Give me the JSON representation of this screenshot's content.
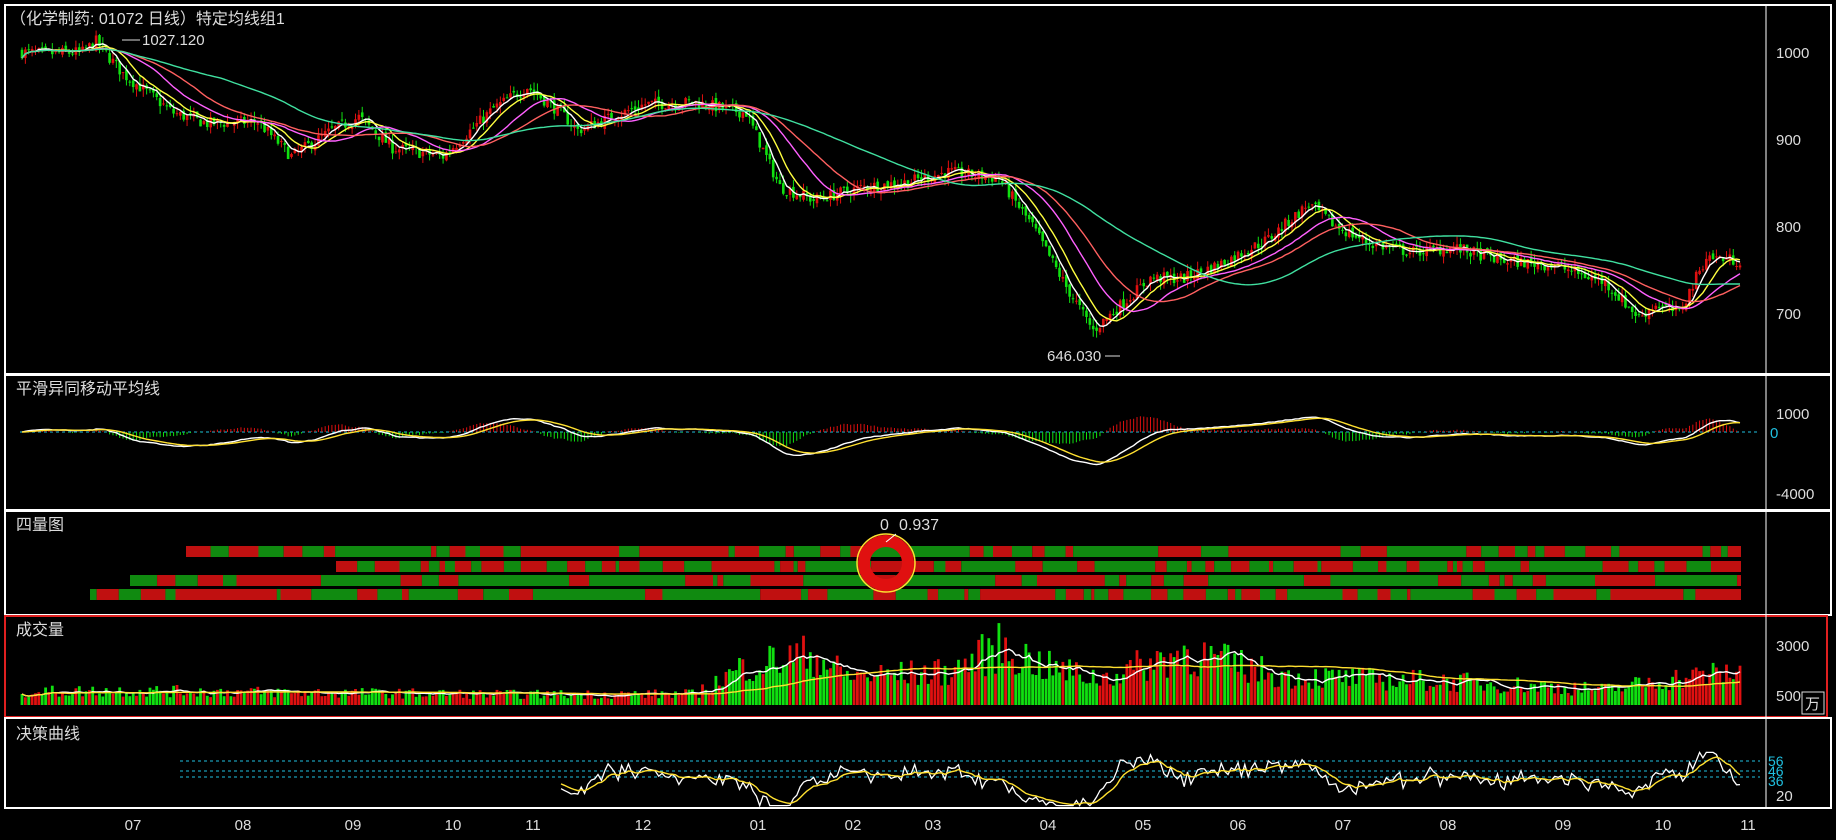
{
  "header": {
    "title": "（化学制药: 01072 日线）特定均线组1",
    "price_max_label": "1027.120",
    "price_min_label": "646.030"
  },
  "panels": {
    "main": {
      "y_ticks": [
        "1000",
        "900",
        "800",
        "700"
      ]
    },
    "macd": {
      "title": "平滑异同移动平均线",
      "y_ticks": [
        "1000",
        "0",
        "-4000"
      ]
    },
    "quad": {
      "title": "四量图",
      "readout_a": "0",
      "readout_b": "0.937"
    },
    "volume": {
      "title": "成交量",
      "y_ticks": [
        "3000",
        "500"
      ],
      "unit": "万"
    },
    "decision": {
      "title": "决策曲线",
      "y_ticks": [
        "56",
        "46",
        "36",
        "20"
      ]
    }
  },
  "x_axis": {
    "months": [
      "07",
      "08",
      "09",
      "10",
      "11",
      "12",
      "01",
      "02",
      "03",
      "04",
      "05",
      "06",
      "07",
      "08",
      "09",
      "10",
      "11"
    ]
  },
  "colors": {
    "up": "#e01010",
    "down": "#10e010",
    "border": "#ffffff",
    "selected_border": "#e02020",
    "ma": [
      "#ffffff",
      "#ffff40",
      "#ff60ff",
      "#ff6060",
      "#40e0a0"
    ],
    "zero_line": "#20c0e0"
  },
  "chart_data": {
    "type": "candlestick",
    "title": "（化学制药: 01072 日线）特定均线组1",
    "price_range": [
      646.03,
      1027.12
    ],
    "anchors": [
      [
        0,
        1000
      ],
      [
        6,
        998
      ],
      [
        18,
        1000
      ],
      [
        22,
        1012
      ],
      [
        30,
        975
      ],
      [
        45,
        930
      ],
      [
        55,
        918
      ],
      [
        70,
        920
      ],
      [
        80,
        880
      ],
      [
        92,
        910
      ],
      [
        100,
        925
      ],
      [
        110,
        890
      ],
      [
        125,
        880
      ],
      [
        140,
        935
      ],
      [
        150,
        960
      ],
      [
        160,
        930
      ],
      [
        165,
        910
      ],
      [
        185,
        940
      ],
      [
        200,
        942
      ],
      [
        215,
        930
      ],
      [
        225,
        845
      ],
      [
        235,
        830
      ],
      [
        250,
        845
      ],
      [
        262,
        850
      ],
      [
        275,
        862
      ],
      [
        290,
        855
      ],
      [
        300,
        800
      ],
      [
        310,
        730
      ],
      [
        318,
        680
      ],
      [
        325,
        705
      ],
      [
        335,
        740
      ],
      [
        345,
        740
      ],
      [
        355,
        755
      ],
      [
        370,
        785
      ],
      [
        382,
        825
      ],
      [
        390,
        800
      ],
      [
        400,
        780
      ],
      [
        412,
        770
      ],
      [
        425,
        775
      ],
      [
        440,
        760
      ],
      [
        455,
        755
      ],
      [
        470,
        735
      ],
      [
        480,
        695
      ],
      [
        485,
        710
      ],
      [
        492,
        700
      ],
      [
        500,
        765
      ],
      [
        510,
        760
      ]
    ],
    "volume_range": [
      0,
      4000
    ],
    "volume_anchors": [
      [
        0,
        600
      ],
      [
        30,
        650
      ],
      [
        100,
        550
      ],
      [
        150,
        480
      ],
      [
        200,
        500
      ],
      [
        215,
        1800
      ],
      [
        235,
        2300
      ],
      [
        245,
        1300
      ],
      [
        275,
        1500
      ],
      [
        290,
        2600
      ],
      [
        305,
        1700
      ],
      [
        320,
        1200
      ],
      [
        345,
        2400
      ],
      [
        375,
        1300
      ],
      [
        420,
        1100
      ],
      [
        470,
        700
      ],
      [
        490,
        1200
      ],
      [
        510,
        1500
      ]
    ],
    "ma_periods": [
      5,
      10,
      20,
      30,
      60
    ]
  }
}
